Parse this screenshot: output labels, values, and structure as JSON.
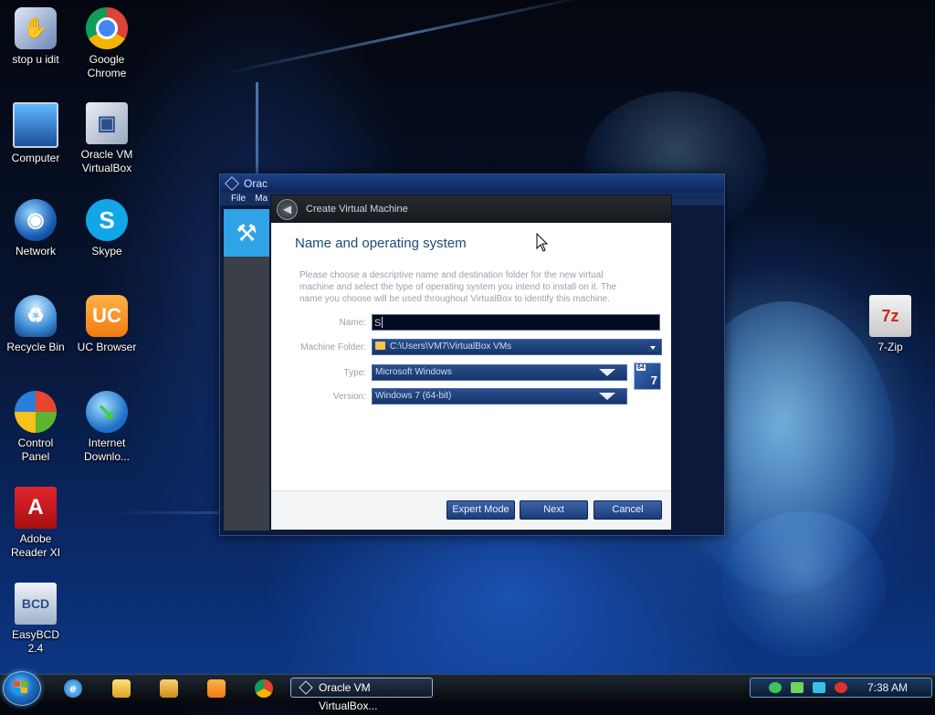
{
  "desktop": {
    "icons": [
      {
        "label": "stop u idit",
        "icon": "shortcut-icon"
      },
      {
        "label": "Google Chrome",
        "icon": "chrome-icon"
      },
      {
        "label": "Computer",
        "icon": "computer-icon"
      },
      {
        "label": "Oracle VM VirtualBox",
        "icon": "virtualbox-icon"
      },
      {
        "label": "Network",
        "icon": "network-icon"
      },
      {
        "label": "Skype",
        "icon": "skype-icon"
      },
      {
        "label": "Recycle Bin",
        "icon": "recycle-bin-icon"
      },
      {
        "label": "UC Browser",
        "icon": "uc-browser-icon"
      },
      {
        "label": "Control Panel",
        "icon": "control-panel-icon"
      },
      {
        "label": "Internet Downlo...",
        "icon": "internet-download-manager-icon"
      },
      {
        "label": "Adobe Reader XI",
        "icon": "adobe-reader-icon"
      },
      {
        "label": "EasyBCD 2.4",
        "icon": "easybcd-icon"
      },
      {
        "label": "7-Zip",
        "icon": "folder-icon"
      }
    ]
  },
  "manager_window": {
    "title": "Orac",
    "menu": [
      "File",
      "Ma"
    ]
  },
  "dialog": {
    "header": "Create Virtual Machine",
    "title": "Name and operating system",
    "description": "Please choose a descriptive name and destination folder for the new virtual machine and select the type of operating system you intend to install on it. The name you choose will be used throughout VirtualBox to identify this machine.",
    "fields": {
      "name_label": "Name:",
      "name_value": "S",
      "folder_label": "Machine Folder:",
      "folder_value": "C:\\Users\\VM7\\VirtualBox VMs",
      "type_label": "Type:",
      "type_value": "Microsoft Windows",
      "version_label": "Version:",
      "version_value": "Windows 7 (64-bit)"
    },
    "os_badge": {
      "bits": "64",
      "version": "7"
    },
    "buttons": {
      "expert": "Expert Mode",
      "next": "Next",
      "cancel": "Cancel"
    }
  },
  "taskbar": {
    "task_label": "Oracle VM VirtualBox...",
    "clock": "7:38 AM"
  },
  "colors": {
    "accent": "#1b4b7d",
    "button": "#1b3c7b",
    "taskbar": "#06090d"
  }
}
